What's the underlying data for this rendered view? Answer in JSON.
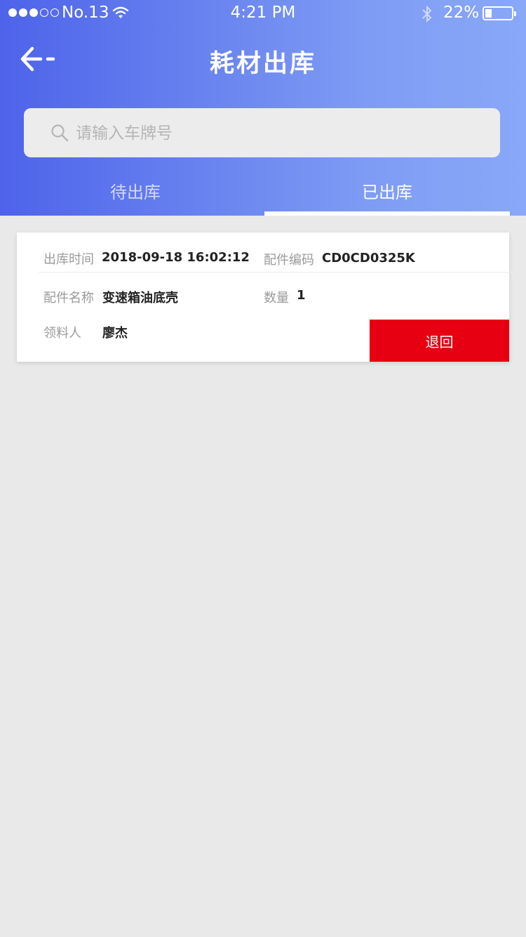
{
  "status_bar": {
    "carrier": "No.13",
    "time": "4:21 PM",
    "battery_percent": "22%",
    "battery_level": 0.22,
    "signal_bars_filled": 3,
    "signal_bars_total": 5
  },
  "header": {
    "title": "耗材出库",
    "back_icon": "arrow-left-icon",
    "gradient_start": "#4e63ea",
    "gradient_end": "#8aa8f8"
  },
  "search": {
    "placeholder": "请输入车牌号",
    "value": ""
  },
  "tabs": [
    {
      "label": "待出库",
      "active": false
    },
    {
      "label": "已出库",
      "active": true
    }
  ],
  "records": [
    {
      "time_label": "出库时间",
      "time_value": "2018-09-18 16:02:12",
      "code_label": "配件编码",
      "code_value": "CD0CD0325K",
      "name_label": "配件名称",
      "name_value": "变速箱油底壳",
      "qty_label": "数量",
      "qty_value": "1",
      "receiver_label": "领料人",
      "receiver_value": "廖杰",
      "action_label": "退回",
      "action_color": "#e60012"
    }
  ]
}
